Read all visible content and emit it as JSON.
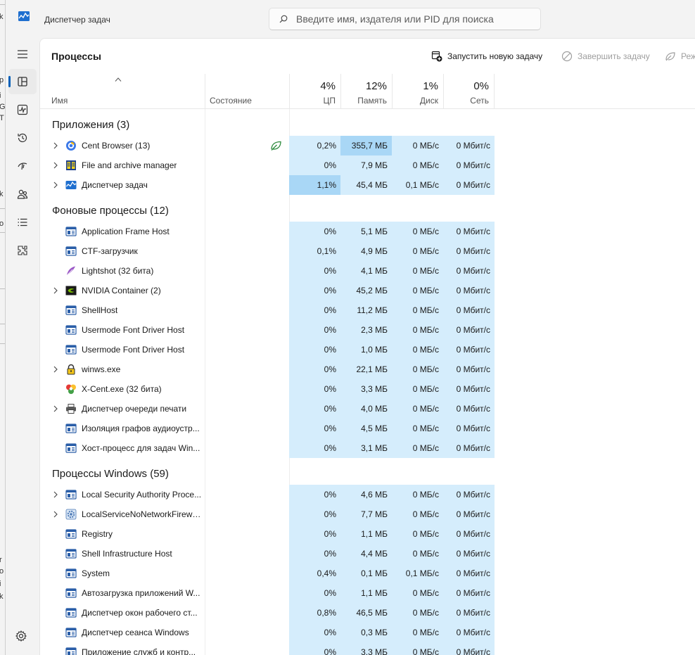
{
  "window": {
    "title": "Диспетчер задач",
    "search_placeholder": "Введите имя, издателя или PID для поиска"
  },
  "nav": [
    {
      "name": "nav-menu",
      "icon": "hamburger-icon"
    },
    {
      "name": "nav-processes",
      "icon": "processes-icon",
      "active": true
    },
    {
      "name": "nav-performance",
      "icon": "performance-icon"
    },
    {
      "name": "nav-app-history",
      "icon": "history-icon"
    },
    {
      "name": "nav-startup",
      "icon": "startup-icon"
    },
    {
      "name": "nav-users",
      "icon": "users-icon"
    },
    {
      "name": "nav-details",
      "icon": "details-icon"
    },
    {
      "name": "nav-services",
      "icon": "services-icon"
    }
  ],
  "page": {
    "title": "Процессы",
    "toolbar": {
      "run_new_task": "Запустить новую задачу",
      "end_task": "Завершить задачу",
      "efficiency": "Реж"
    }
  },
  "columns": {
    "name": "Имя",
    "status": "Состояние",
    "cpu_pct": "4%",
    "cpu": "ЦП",
    "mem_pct": "12%",
    "mem": "Память",
    "disk_pct": "1%",
    "disk": "Диск",
    "net_pct": "0%",
    "net": "Сеть"
  },
  "groups": [
    {
      "title": "Приложения (3)",
      "rows": [
        {
          "name": "Cent Browser (13)",
          "icon": "cent-browser-icon",
          "expand": true,
          "eco": true,
          "cpu": "0,2%",
          "mem": "355,7 МБ",
          "disk": "0 МБ/с",
          "net": "0 Мбит/с",
          "hot": "mem"
        },
        {
          "name": "File and archive manager",
          "icon": "file-manager-icon",
          "expand": true,
          "cpu": "0%",
          "mem": "7,9 МБ",
          "disk": "0 МБ/с",
          "net": "0 Мбит/с"
        },
        {
          "name": "Диспетчер задач",
          "icon": "task-manager-icon",
          "expand": true,
          "cpu": "1,1%",
          "mem": "45,4 МБ",
          "disk": "0,1 МБ/с",
          "net": "0 Мбит/с",
          "hot": "cpu"
        }
      ]
    },
    {
      "title": "Фоновые процессы (12)",
      "rows": [
        {
          "name": "Application Frame Host",
          "icon": "window-icon",
          "cpu": "0%",
          "mem": "5,1 МБ",
          "disk": "0 МБ/с",
          "net": "0 Мбит/с"
        },
        {
          "name": "CTF-загрузчик",
          "icon": "window-icon",
          "cpu": "0,1%",
          "mem": "4,9 МБ",
          "disk": "0 МБ/с",
          "net": "0 Мбит/с"
        },
        {
          "name": "Lightshot (32 бита)",
          "icon": "feather-icon",
          "cpu": "0%",
          "mem": "4,1 МБ",
          "disk": "0 МБ/с",
          "net": "0 Мбит/с"
        },
        {
          "name": "NVIDIA Container (2)",
          "icon": "nvidia-icon",
          "expand": true,
          "cpu": "0%",
          "mem": "45,2 МБ",
          "disk": "0 МБ/с",
          "net": "0 Мбит/с"
        },
        {
          "name": "ShellHost",
          "icon": "window-icon",
          "cpu": "0%",
          "mem": "11,2 МБ",
          "disk": "0 МБ/с",
          "net": "0 Мбит/с"
        },
        {
          "name": "Usermode Font Driver Host",
          "icon": "window-icon",
          "cpu": "0%",
          "mem": "2,3 МБ",
          "disk": "0 МБ/с",
          "net": "0 Мбит/с"
        },
        {
          "name": "Usermode Font Driver Host",
          "icon": "window-icon",
          "cpu": "0%",
          "mem": "1,0 МБ",
          "disk": "0 МБ/с",
          "net": "0 Мбит/с"
        },
        {
          "name": "winws.exe",
          "icon": "lock-icon",
          "expand": true,
          "cpu": "0%",
          "mem": "22,1 МБ",
          "disk": "0 МБ/с",
          "net": "0 Мбит/с"
        },
        {
          "name": "X-Cent.exe (32 бита)",
          "icon": "xcent-icon",
          "cpu": "0%",
          "mem": "3,3 МБ",
          "disk": "0 МБ/с",
          "net": "0 Мбит/с"
        },
        {
          "name": "Диспетчер очереди печати",
          "icon": "printer-icon",
          "expand": true,
          "cpu": "0%",
          "mem": "4,0 МБ",
          "disk": "0 МБ/с",
          "net": "0 Мбит/с"
        },
        {
          "name": "Изоляция графов аудиоустр...",
          "icon": "window-icon",
          "cpu": "0%",
          "mem": "4,5 МБ",
          "disk": "0 МБ/с",
          "net": "0 Мбит/с"
        },
        {
          "name": "Хост-процесс для задач Win...",
          "icon": "window-icon",
          "cpu": "0%",
          "mem": "3,1 МБ",
          "disk": "0 МБ/с",
          "net": "0 Мбит/с"
        }
      ]
    },
    {
      "title": "Процессы Windows (59)",
      "rows": [
        {
          "name": "Local Security Authority Proce...",
          "icon": "window-icon",
          "expand": true,
          "cpu": "0%",
          "mem": "4,6 МБ",
          "disk": "0 МБ/с",
          "net": "0 Мбит/с"
        },
        {
          "name": "LocalServiceNoNetworkFirewa...",
          "icon": "gear-service-icon",
          "expand": true,
          "cpu": "0%",
          "mem": "7,7 МБ",
          "disk": "0 МБ/с",
          "net": "0 Мбит/с"
        },
        {
          "name": "Registry",
          "icon": "window-icon",
          "cpu": "0%",
          "mem": "1,1 МБ",
          "disk": "0 МБ/с",
          "net": "0 Мбит/с"
        },
        {
          "name": "Shell Infrastructure Host",
          "icon": "window-icon",
          "cpu": "0%",
          "mem": "4,4 МБ",
          "disk": "0 МБ/с",
          "net": "0 Мбит/с"
        },
        {
          "name": "System",
          "icon": "window-icon",
          "cpu": "0,4%",
          "mem": "0,1 МБ",
          "disk": "0,1 МБ/с",
          "net": "0 Мбит/с"
        },
        {
          "name": "Автозагрузка приложений W...",
          "icon": "window-icon",
          "cpu": "0%",
          "mem": "1,1 МБ",
          "disk": "0 МБ/с",
          "net": "0 Мбит/с"
        },
        {
          "name": "Диспетчер окон рабочего ст...",
          "icon": "window-icon",
          "cpu": "0,8%",
          "mem": "46,5 МБ",
          "disk": "0 МБ/с",
          "net": "0 Мбит/с"
        },
        {
          "name": "Диспетчер сеанса  Windows",
          "icon": "window-icon",
          "cpu": "0%",
          "mem": "0,3 МБ",
          "disk": "0 МБ/с",
          "net": "0 Мбит/с"
        },
        {
          "name": "Приложение служб и контр...",
          "icon": "window-icon",
          "cpu": "0%",
          "mem": "3,3 МБ",
          "disk": "0 МБ/с",
          "net": "0 Мбит/с"
        }
      ]
    }
  ],
  "colors": {
    "accent": "#005fb8",
    "cell_bg": "#d5edfc",
    "cell_hot": "#a9d7f6"
  }
}
